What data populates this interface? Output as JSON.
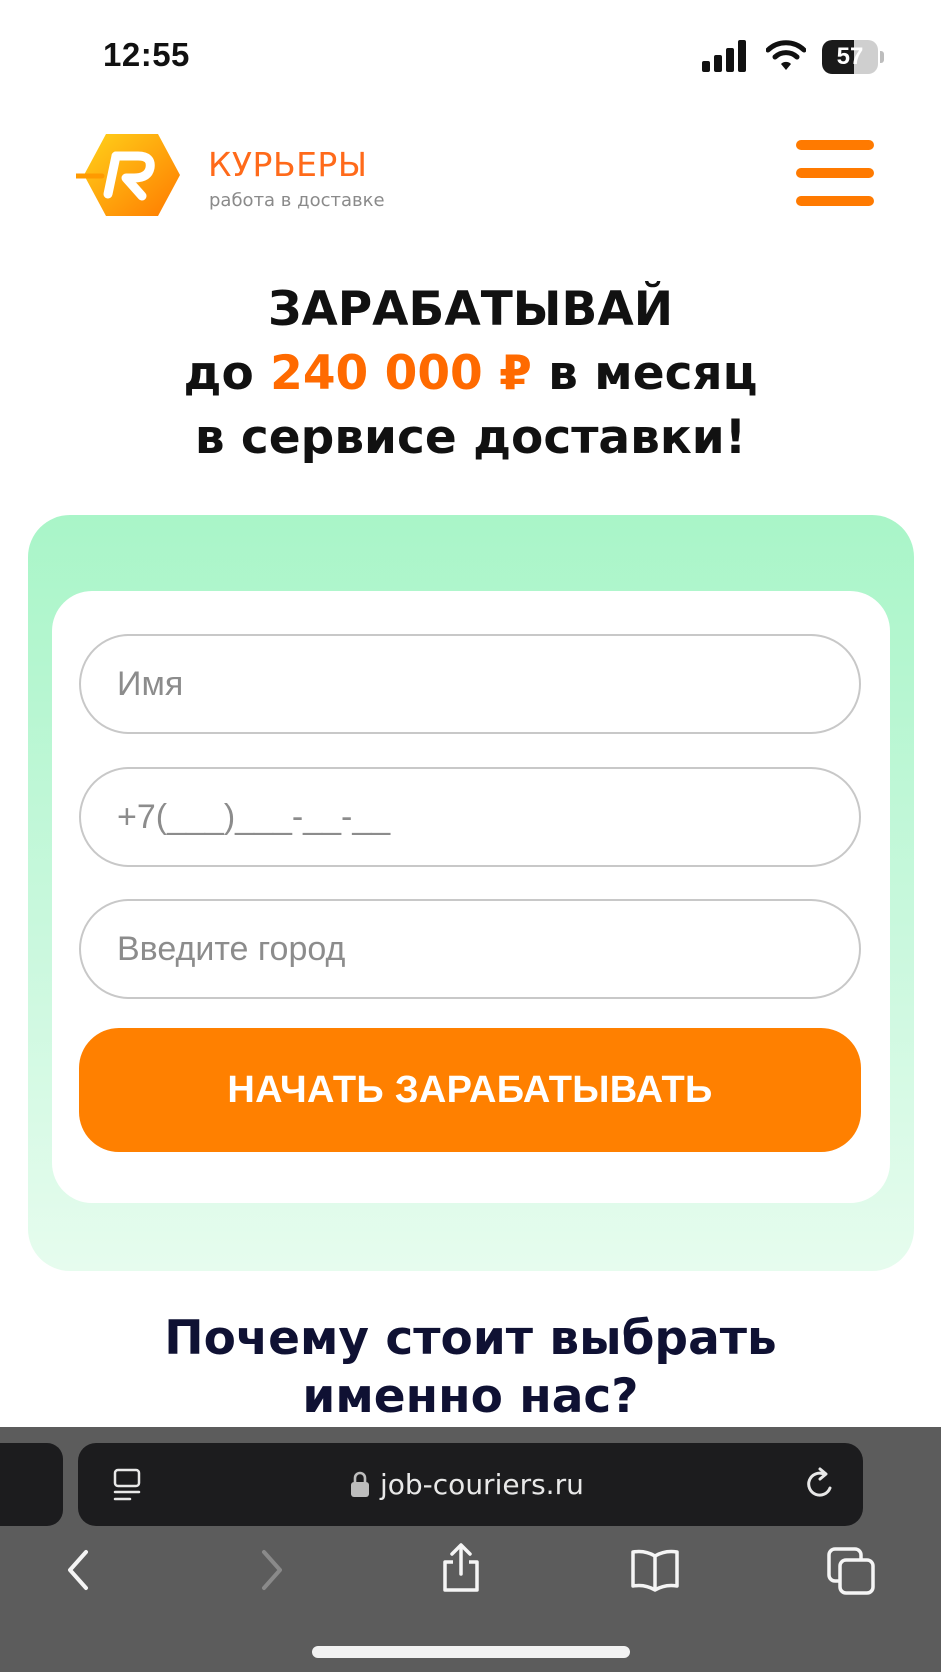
{
  "status_bar": {
    "time": "12:55",
    "battery_level": "57",
    "icons": [
      "signal-icon",
      "wifi-icon",
      "battery-icon"
    ]
  },
  "header": {
    "brand_name": "КУРЬЕРЫ",
    "brand_tagline": "работа в доставке",
    "logo_icon": "courier-logo-icon",
    "menu_icon": "hamburger-menu-icon",
    "accent_color": "#ff7a00"
  },
  "hero": {
    "line1": "ЗАРАБАТЫВАЙ",
    "line2_prefix": "до ",
    "line2_amount": "240 000 ₽",
    "line2_suffix": " в месяц",
    "line3": "в сервисе доставки!"
  },
  "form": {
    "name_placeholder": "Имя",
    "phone_placeholder": "+7(___)___-__-__",
    "city_placeholder": "Введите город",
    "submit_label": "НАЧАТЬ ЗАРАБАТЫВАТЬ",
    "button_color": "#ff8000",
    "panel_color": "#a9f5c8"
  },
  "why_section": {
    "title_line1": "Почему стоит выбрать",
    "title_line2": "именно нас?"
  },
  "browser": {
    "url": "job-couriers.ru",
    "icons": [
      "reader-icon",
      "lock-icon",
      "reload-icon",
      "back-icon",
      "forward-icon",
      "share-icon",
      "bookmarks-icon",
      "tabs-icon"
    ]
  }
}
